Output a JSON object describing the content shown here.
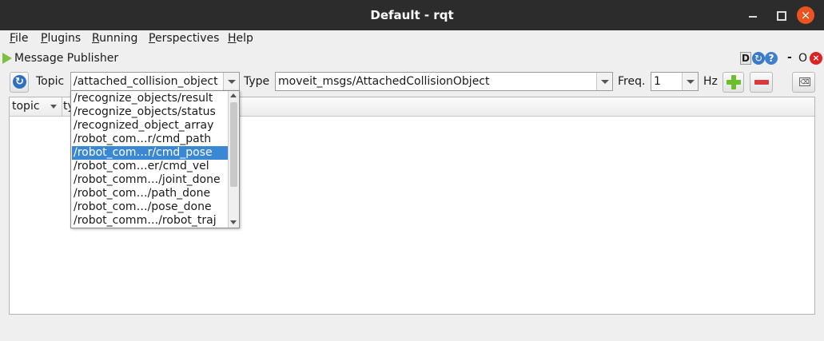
{
  "window": {
    "title": "Default - rqt",
    "close_glyph": "×"
  },
  "menu": [
    {
      "u": "F",
      "rest": "ile"
    },
    {
      "u": "P",
      "rest": "lugins"
    },
    {
      "u": "R",
      "rest": "unning"
    },
    {
      "u": "P",
      "rest": "erspectives"
    },
    {
      "u": "H",
      "rest": "elp"
    }
  ],
  "plugin": {
    "title": "Message Publisher",
    "d_label": "D",
    "reload_glyph": "↻",
    "help_glyph": "?",
    "min_label": "-",
    "o_label": "O",
    "close_glyph": "×"
  },
  "toolbar": {
    "refresh_glyph": "↻",
    "topic_label": "Topic",
    "topic_value": "/attached_collision_object",
    "type_label": "Type",
    "type_value": "moveit_msgs/AttachedCollisionObject",
    "freq_label": "Freq.",
    "freq_value": "1",
    "hz_label": "Hz",
    "clear_glyph": "⌫"
  },
  "table": {
    "col_topic": "topic",
    "col_type_partial": "ty"
  },
  "dropdown": {
    "items": [
      "/recognize_objects/result",
      "/recognize_objects/status",
      "/recognized_object_array",
      "/robot_com…r/cmd_path",
      "/robot_com…r/cmd_pose",
      "/robot_com…er/cmd_vel",
      "/robot_comm…/joint_done",
      "/robot_com…/path_done",
      "/robot_com…/pose_done",
      "/robot_comm…/robot_traj"
    ],
    "selected_index": 4
  },
  "colors": {
    "titlebar": "#2c2c2c",
    "selection": "#3a87d4",
    "close": "#e95420"
  }
}
